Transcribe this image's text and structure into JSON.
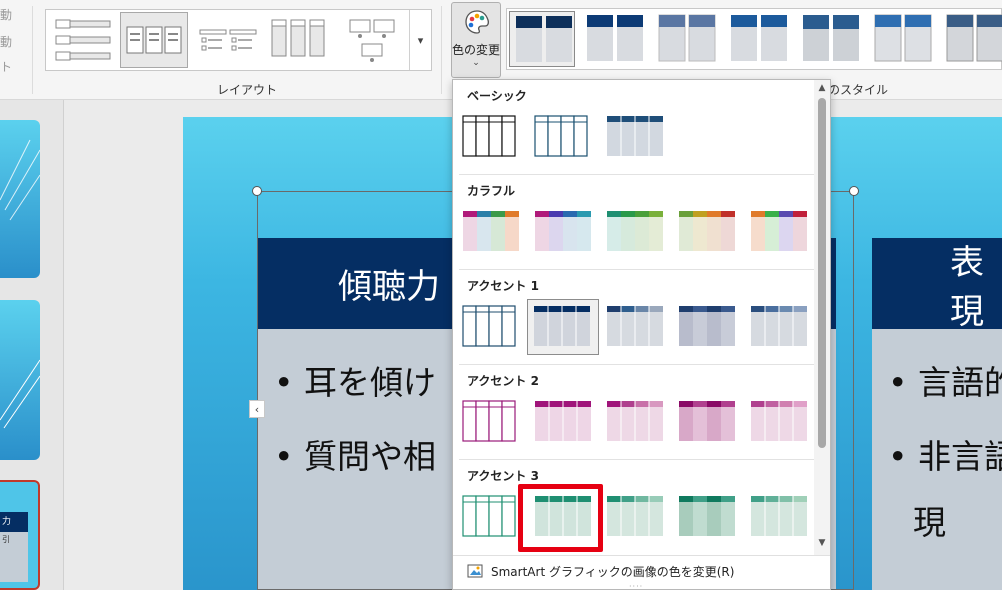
{
  "ribbon": {
    "left_commands": [
      "動",
      "動",
      "ト"
    ],
    "layout_group_label": "レイアウト",
    "color_button_label": "色の変更",
    "styles_group_label": "SmartArt のスタイル"
  },
  "slide": {
    "col1_title": "傾聴力",
    "col1_bullets": [
      "耳を傾け",
      "質問や相"
    ],
    "col2_title": "表現",
    "col2_bullets": [
      "言語的",
      "非言語",
      "現"
    ],
    "thumb3_lines": [
      "力",
      "引"
    ]
  },
  "dropdown": {
    "sections": [
      {
        "title": "ベーシック"
      },
      {
        "title": "カラフル"
      },
      {
        "title": "アクセント 1"
      },
      {
        "title": "アクセント 2"
      },
      {
        "title": "アクセント 3"
      }
    ],
    "footer_text": "SmartArt グラフィックの画像の色を変更(R)",
    "accent_colors": {
      "navy": "#052e63",
      "blue_grey": "#1f4e79",
      "magenta": "#a0147a",
      "teal": "#1f8f72",
      "highlight_red": "#e60012"
    }
  }
}
